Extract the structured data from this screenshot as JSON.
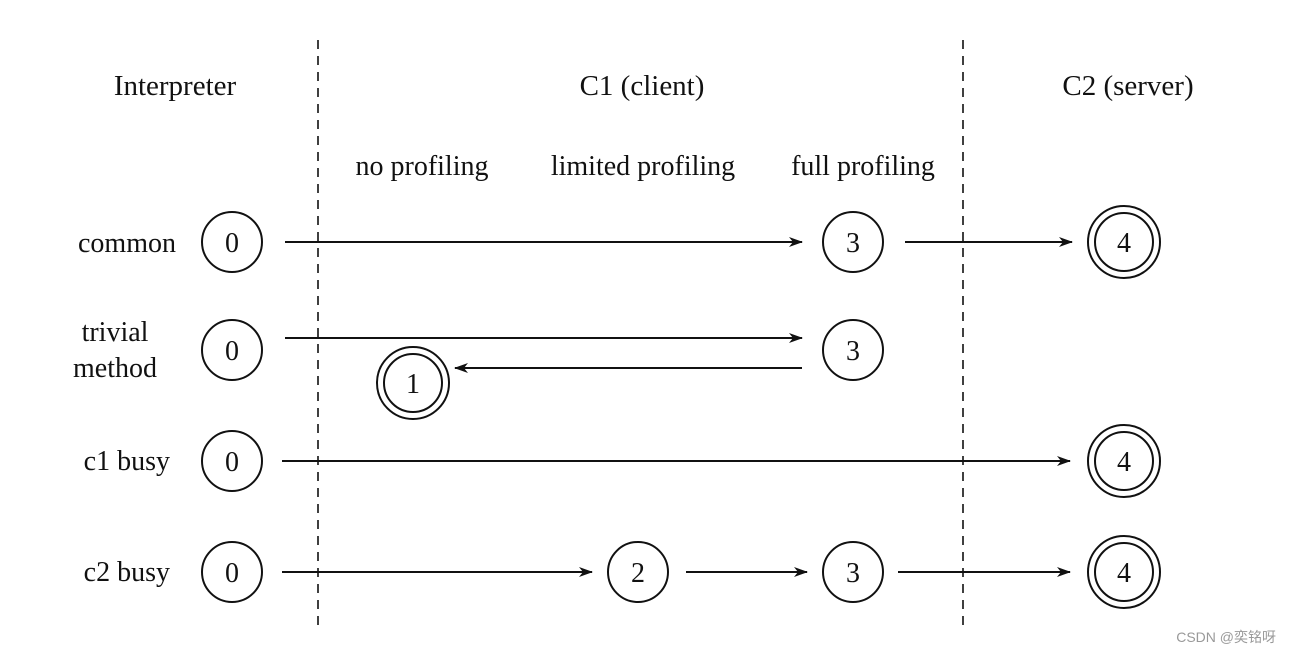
{
  "columns": {
    "interpreter": "Interpreter",
    "c1": "C1 (client)",
    "c2": "C2 (server)"
  },
  "profiling": {
    "none": "no profiling",
    "limited": "limited profiling",
    "full": "full profiling"
  },
  "rows": {
    "common": "common",
    "trivial_line1": "trivial",
    "trivial_line2": "method",
    "c1_busy": "c1 busy",
    "c2_busy": "c2 busy"
  },
  "nodes": {
    "common": [
      "0",
      "3",
      "4"
    ],
    "trivial": [
      "0",
      "3",
      "1"
    ],
    "c1_busy": [
      "0",
      "4"
    ],
    "c2_busy": [
      "0",
      "2",
      "3",
      "4"
    ]
  },
  "watermark": "CSDN @奕铭呀"
}
